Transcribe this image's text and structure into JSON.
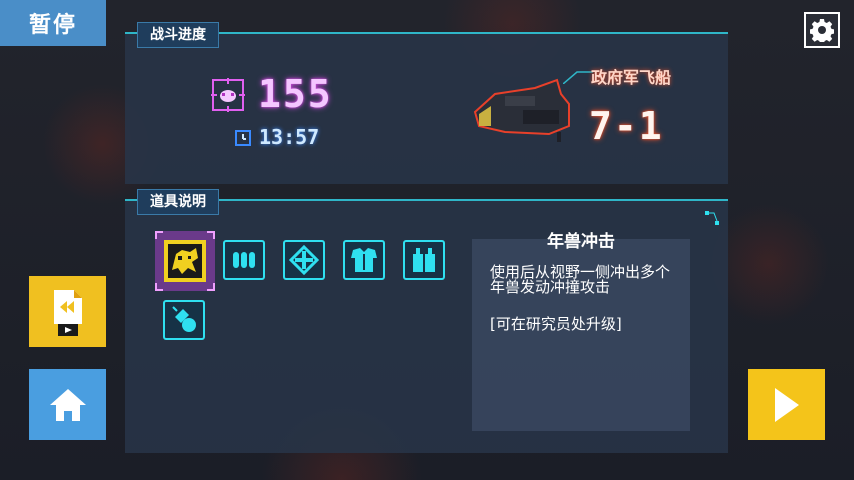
{
  "header": {
    "pause_label": "暂停"
  },
  "battle": {
    "tag": "战斗进度",
    "kill_count": "155",
    "time": "13:57",
    "ship_name": "政府军飞船",
    "stage": "7-1"
  },
  "items": {
    "tag": "道具说明",
    "icons": [
      "beast-charge-icon",
      "bullets-icon",
      "crosshair-icon",
      "armor-icon",
      "bottles-icon",
      "grenade-icon"
    ],
    "selected": {
      "name": "年兽冲击",
      "description": "使用后从视野一侧冲出多个年兽发动冲撞攻击",
      "note": "[可在研究员处升级]"
    }
  },
  "colors": {
    "accent_cyan": "#2fe0f0",
    "pause_blue": "#4a8ec8",
    "button_yellow": "#f4c41a",
    "kill_pink": "#d04adf",
    "stage_orange": "#e8502a"
  }
}
